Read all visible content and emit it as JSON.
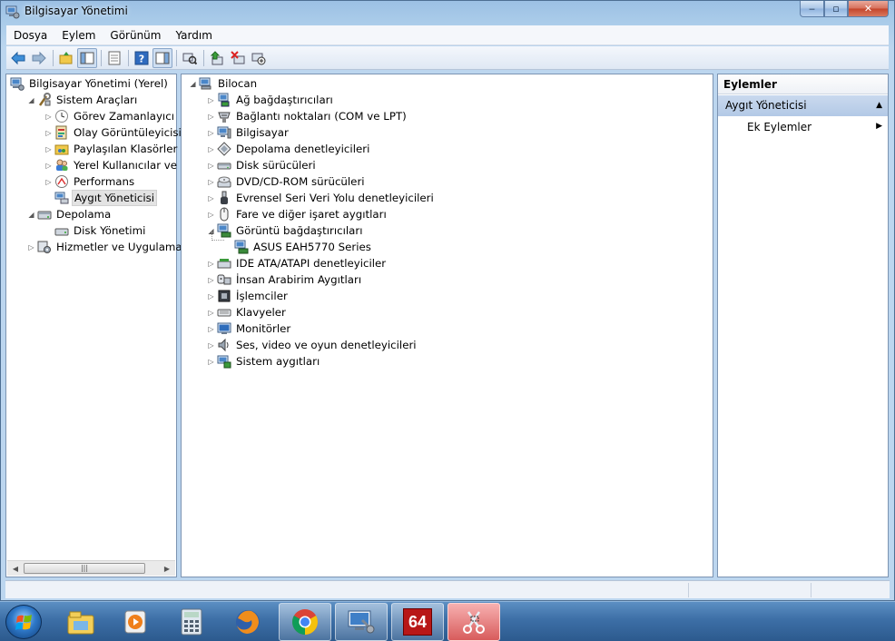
{
  "window": {
    "title": "Bilgisayar Yönetimi",
    "caption": {
      "minimize": "‒",
      "maximize": "▫",
      "close": "✕"
    }
  },
  "menu": [
    "Dosya",
    "Eylem",
    "Görünüm",
    "Yardım"
  ],
  "left_tree": [
    {
      "label": "Bilgisayar Yönetimi (Yerel)",
      "icon": "computer-management-icon",
      "expander": "none"
    },
    {
      "label": "Sistem Araçları",
      "icon": "system-tools-icon",
      "expander": "expanded"
    },
    {
      "label": "Görev Zamanlayıcı",
      "icon": "clock-icon",
      "expander": "collapsed"
    },
    {
      "label": "Olay Görüntüleyicisi",
      "icon": "event-viewer-icon",
      "expander": "collapsed"
    },
    {
      "label": "Paylaşılan Klasörler",
      "icon": "shared-folder-icon",
      "expander": "collapsed"
    },
    {
      "label": "Yerel Kullanıcılar ve Gru",
      "icon": "users-icon",
      "expander": "collapsed"
    },
    {
      "label": "Performans",
      "icon": "performance-icon",
      "expander": "collapsed"
    },
    {
      "label": "Aygıt Yöneticisi",
      "icon": "device-manager-icon",
      "expander": "none",
      "selected": true
    },
    {
      "label": "Depolama",
      "icon": "storage-icon",
      "expander": "expanded"
    },
    {
      "label": "Disk Yönetimi",
      "icon": "disk-management-icon",
      "expander": "none"
    },
    {
      "label": "Hizmetler ve Uygulamalar",
      "icon": "services-icon",
      "expander": "collapsed"
    }
  ],
  "device_tree": {
    "root": "Bilocan",
    "items": [
      {
        "label": "Ağ bağdaştırıcıları",
        "icon": "network-adapter-icon",
        "expander": "collapsed"
      },
      {
        "label": "Bağlantı noktaları (COM ve LPT)",
        "icon": "port-icon",
        "expander": "collapsed"
      },
      {
        "label": "Bilgisayar",
        "icon": "computer-icon",
        "expander": "collapsed"
      },
      {
        "label": "Depolama denetleyicileri",
        "icon": "storage-controller-icon",
        "expander": "collapsed"
      },
      {
        "label": "Disk sürücüleri",
        "icon": "disk-drive-icon",
        "expander": "collapsed"
      },
      {
        "label": "DVD/CD-ROM sürücüleri",
        "icon": "dvd-drive-icon",
        "expander": "collapsed"
      },
      {
        "label": "Evrensel Seri Veri Yolu denetleyicileri",
        "icon": "usb-icon",
        "expander": "collapsed"
      },
      {
        "label": "Fare ve diğer işaret aygıtları",
        "icon": "mouse-icon",
        "expander": "collapsed"
      },
      {
        "label": "Görüntü bağdaştırıcıları",
        "icon": "display-adapter-icon",
        "expander": "expanded"
      },
      {
        "label": "ASUS EAH5770 Series",
        "icon": "display-adapter-icon",
        "expander": "child"
      },
      {
        "label": "IDE ATA/ATAPI denetleyiciler",
        "icon": "ide-controller-icon",
        "expander": "collapsed"
      },
      {
        "label": "İnsan Arabirim Aygıtları",
        "icon": "hid-icon",
        "expander": "collapsed"
      },
      {
        "label": "İşlemciler",
        "icon": "processor-icon",
        "expander": "collapsed"
      },
      {
        "label": "Klavyeler",
        "icon": "keyboard-icon",
        "expander": "collapsed"
      },
      {
        "label": "Monitörler",
        "icon": "monitor-icon",
        "expander": "collapsed"
      },
      {
        "label": "Ses, video ve oyun denetleyicileri",
        "icon": "speaker-icon",
        "expander": "collapsed"
      },
      {
        "label": "Sistem aygıtları",
        "icon": "system-devices-icon",
        "expander": "collapsed"
      }
    ]
  },
  "actions": {
    "header": "Eylemler",
    "section": "Aygıt Yöneticisi",
    "more": "Ek Eylemler"
  },
  "scrollbar": {
    "thumb_grip": "|||"
  },
  "taskbar": {
    "apps": [
      "explorer-icon",
      "media-player-icon",
      "calculator-icon",
      "firefox-icon",
      "chrome-icon",
      "computer-management-icon",
      "aida64-icon",
      "snipping-tool-icon"
    ],
    "aida_label": "64"
  },
  "colors": {
    "window_frame": "#bcd6ef",
    "selection": "#e3e3e3",
    "actions_section": "#c9d9ee",
    "taskbar": "#3d6fa6"
  }
}
